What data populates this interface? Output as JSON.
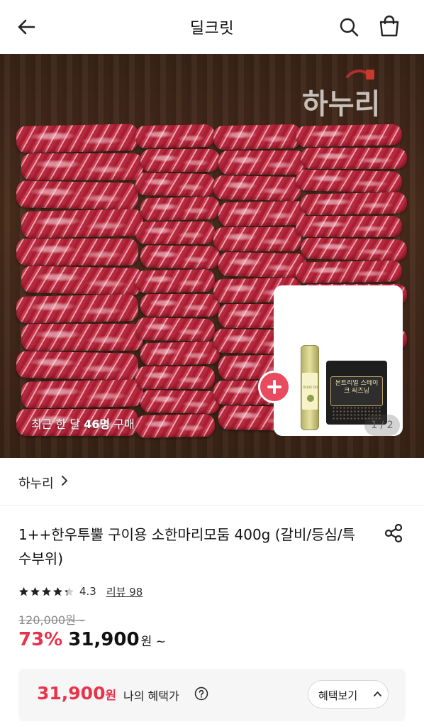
{
  "header": {
    "title": "딜크릿",
    "icons": {
      "back": "arrow-left-icon",
      "search": "search-icon",
      "cart": "shopping-bag-icon"
    }
  },
  "hero": {
    "brand_logo_text": "하누리",
    "purchase_prefix": "최근 한 달 ",
    "purchase_count": "46명",
    "purchase_suffix": " 구매",
    "page_indicator": "1 / 2",
    "promo_items": {
      "oil_label": "OLIVE OIL",
      "spice_label": "몬트리얼 스테이크 씨즈닝"
    }
  },
  "brand": {
    "name": "하누리",
    "chevron": "chevron-right-icon"
  },
  "product": {
    "title": "1++한우투뿔 구이용 소한마리모둠 400g (갈비/등심/특수부위)",
    "rating": {
      "value": 4.3,
      "display": "4.3",
      "stars_filled": 4.3,
      "stars_total": 5
    },
    "review_text": "리뷰 98",
    "original_price": "120,000원~",
    "discount": "73%",
    "price": "31,900",
    "price_suffix": "원 ~"
  },
  "benefit": {
    "price": "31,900",
    "price_unit": "원",
    "label": "나의 혜택가",
    "button_label": "혜택보기"
  },
  "colors": {
    "accent": "#e8334a",
    "star": "#222222",
    "benefit_bg": "#f6f6f7"
  }
}
